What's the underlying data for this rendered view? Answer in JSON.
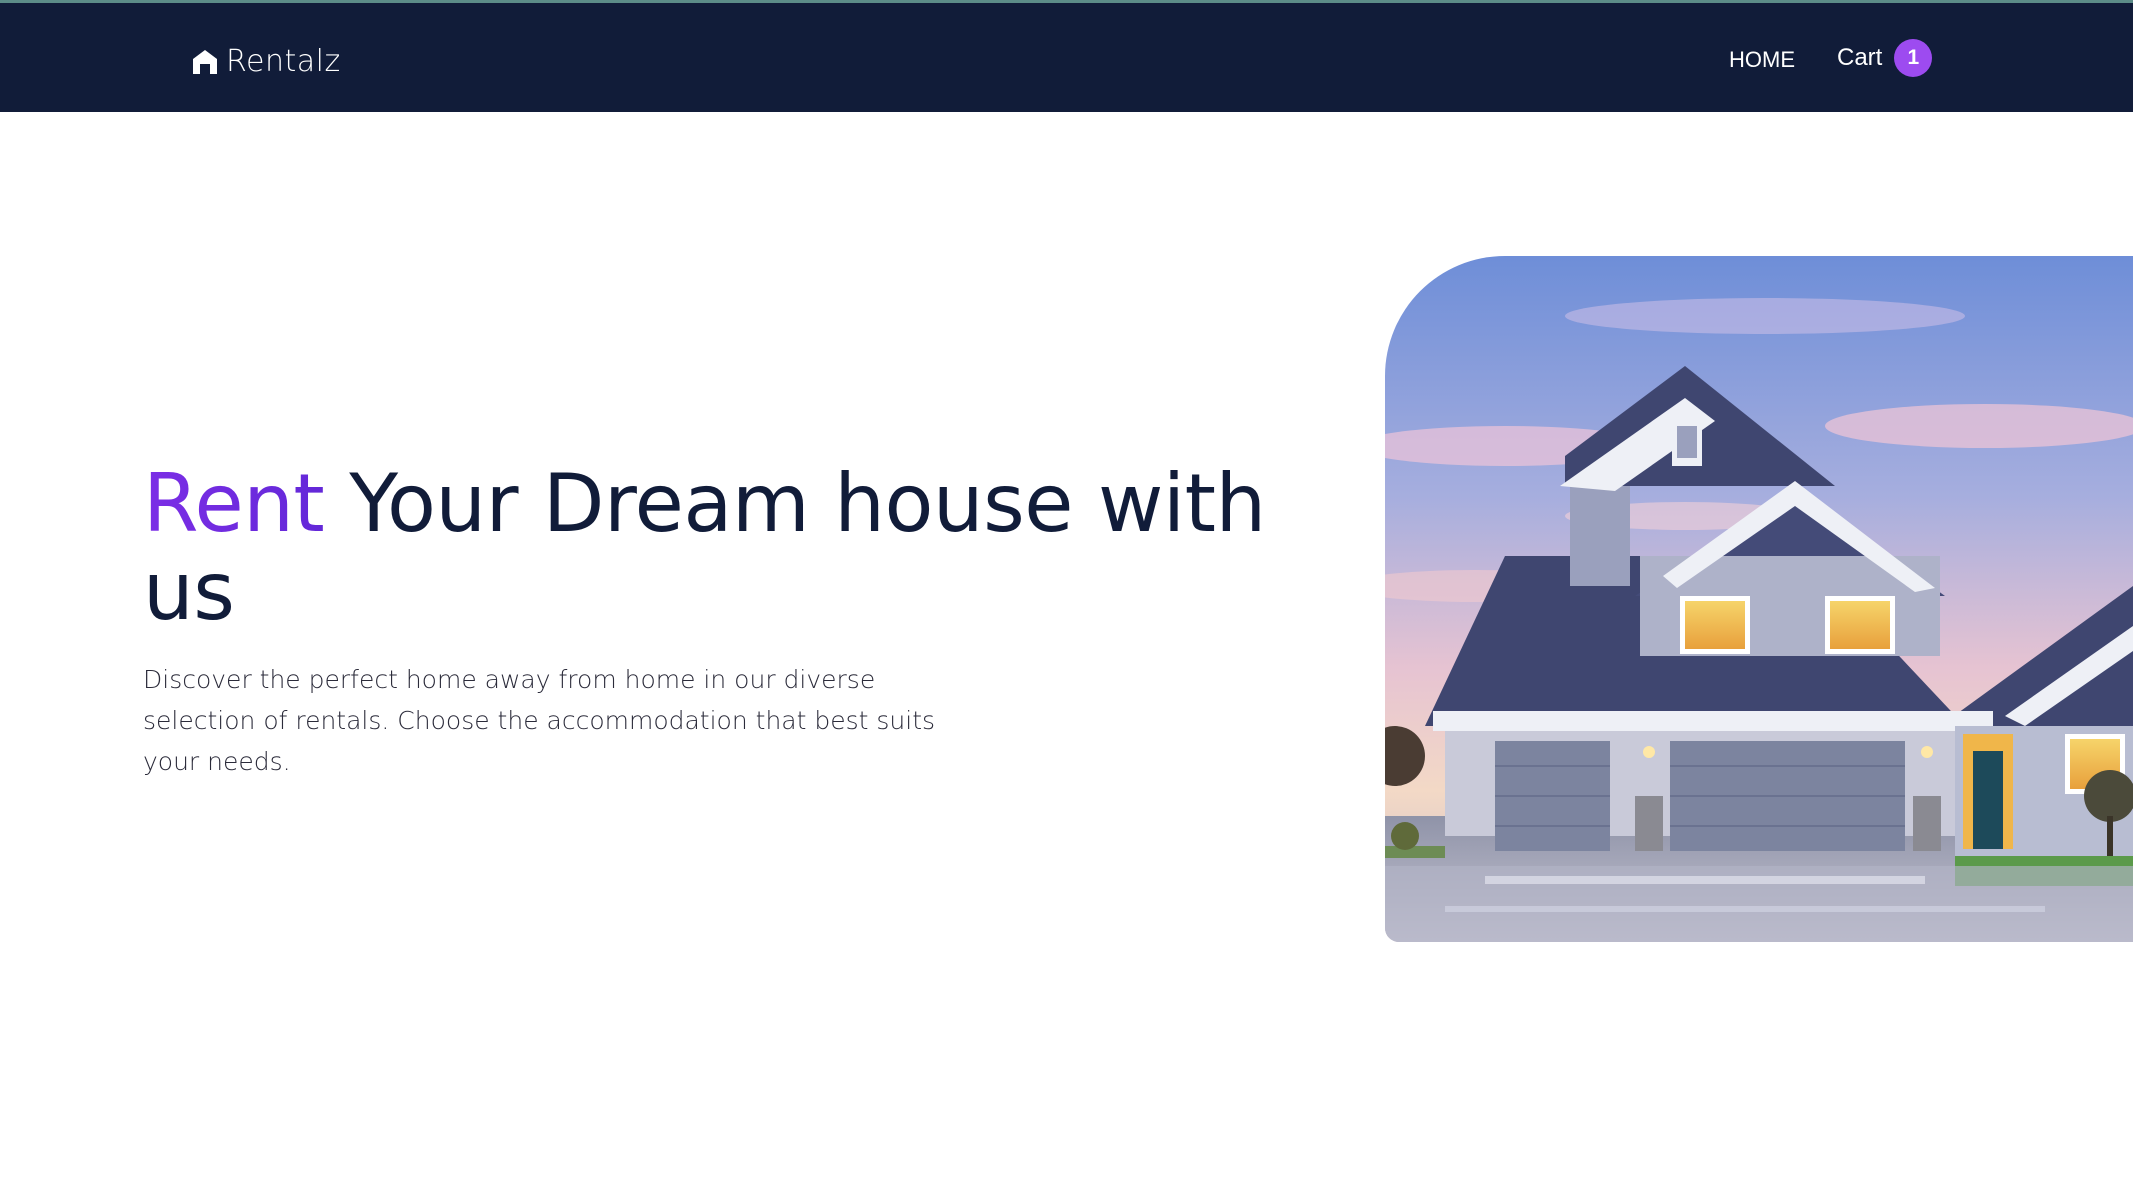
{
  "nav": {
    "brand": "Rentalz",
    "home_label": "HOME",
    "cart_label": "Cart",
    "cart_count": "1"
  },
  "hero": {
    "title_accent": "Rent",
    "title_rest": "Your Dream house with us",
    "description": "Discover the perfect home away from home in our diverse selection of rentals. Choose the accommodation that best suits your needs."
  },
  "colors": {
    "navbar_bg": "#111c39",
    "accent": "#6f2ddf",
    "badge": "#9d4bf0",
    "heading": "#111c39"
  },
  "icons": {
    "brand": "house-icon"
  }
}
